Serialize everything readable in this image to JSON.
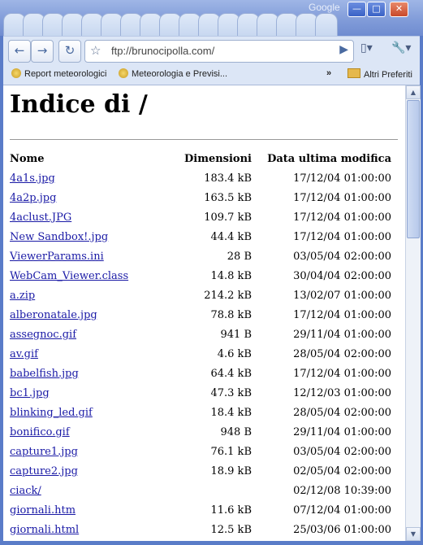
{
  "window": {
    "brand": "Google",
    "controls": {
      "minimize": "—",
      "maximize": "□",
      "close": "✕"
    }
  },
  "toolbar": {
    "back_icon": "←",
    "forward_icon": "→",
    "reload_icon": "↻",
    "address_value": "ftp://brunocipolla.com/",
    "go_icon": "▶",
    "page_menu_icon": "▯▾",
    "wrench_menu_icon": "🔧▾"
  },
  "bookmarks": {
    "items": [
      {
        "label": "Report meteorologici"
      },
      {
        "label": "Meteorologia e Previsi..."
      }
    ],
    "overflow": "»",
    "other": "Altri Preferiti"
  },
  "page": {
    "heading": "Indice di /",
    "columns": {
      "name": "Nome",
      "size": "Dimensioni",
      "date": "Data ultima modifica"
    },
    "rows": [
      {
        "name": "4a1s.jpg",
        "size": "183.4 kB",
        "date": "17/12/04 01:00:00"
      },
      {
        "name": "4a2p.jpg",
        "size": "163.5 kB",
        "date": "17/12/04 01:00:00"
      },
      {
        "name": "4aclust.JPG",
        "size": "109.7 kB",
        "date": "17/12/04 01:00:00"
      },
      {
        "name": "New Sandbox!.jpg",
        "size": "44.4 kB",
        "date": "17/12/04 01:00:00"
      },
      {
        "name": "ViewerParams.ini",
        "size": "28 B",
        "date": "03/05/04 02:00:00"
      },
      {
        "name": "WebCam_Viewer.class",
        "size": "14.8 kB",
        "date": "30/04/04 02:00:00"
      },
      {
        "name": "a.zip",
        "size": "214.2 kB",
        "date": "13/02/07 01:00:00"
      },
      {
        "name": "alberonatale.jpg",
        "size": "78.8 kB",
        "date": "17/12/04 01:00:00"
      },
      {
        "name": "assegnoc.gif",
        "size": "941 B",
        "date": "29/11/04 01:00:00"
      },
      {
        "name": "av.gif",
        "size": "4.6 kB",
        "date": "28/05/04 02:00:00"
      },
      {
        "name": "babelfish.jpg",
        "size": "64.4 kB",
        "date": "17/12/04 01:00:00"
      },
      {
        "name": "bc1.jpg",
        "size": "47.3 kB",
        "date": "12/12/03 01:00:00"
      },
      {
        "name": "blinking_led.gif",
        "size": "18.4 kB",
        "date": "28/05/04 02:00:00"
      },
      {
        "name": "bonifico.gif",
        "size": "948 B",
        "date": "29/11/04 01:00:00"
      },
      {
        "name": "capture1.jpg",
        "size": "76.1 kB",
        "date": "03/05/04 02:00:00"
      },
      {
        "name": "capture2.jpg",
        "size": "18.9 kB",
        "date": "02/05/04 02:00:00"
      },
      {
        "name": "ciack/",
        "size": "",
        "date": "02/12/08 10:39:00"
      },
      {
        "name": "giornali.htm",
        "size": "11.6 kB",
        "date": "07/12/04 01:00:00"
      },
      {
        "name": "giornali.html",
        "size": "12.5 kB",
        "date": "25/03/06 01:00:00"
      }
    ]
  },
  "scrollbar": {
    "up_icon": "▲",
    "down_icon": "▼"
  }
}
